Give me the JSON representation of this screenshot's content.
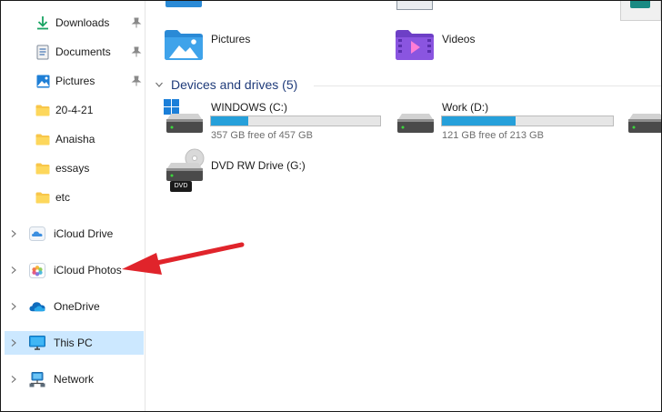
{
  "sidebar": {
    "quick_access": [
      {
        "label": "Downloads",
        "icon": "download-icon"
      },
      {
        "label": "Documents",
        "icon": "documents-icon"
      },
      {
        "label": "Pictures",
        "icon": "pictures-icon"
      },
      {
        "label": "20-4-21",
        "icon": "folder-icon"
      },
      {
        "label": "Anaisha",
        "icon": "folder-icon"
      },
      {
        "label": "essays",
        "icon": "folder-icon"
      },
      {
        "label": "etc",
        "icon": "folder-icon"
      }
    ],
    "locations": [
      {
        "label": "iCloud Drive",
        "icon": "icloud-drive-icon"
      },
      {
        "label": "iCloud Photos",
        "icon": "icloud-photos-icon"
      },
      {
        "label": "OneDrive",
        "icon": "onedrive-icon"
      },
      {
        "label": "This PC",
        "icon": "this-pc-icon",
        "selected": true
      },
      {
        "label": "Network",
        "icon": "network-icon"
      }
    ]
  },
  "main": {
    "folders": [
      {
        "label": "Pictures",
        "icon": "pictures-folder-icon"
      },
      {
        "label": "Videos",
        "icon": "videos-folder-icon"
      }
    ],
    "devices_header": "Devices and drives (5)",
    "drives": [
      {
        "name": "WINDOWS (C:)",
        "free_text": "357 GB free of 457 GB",
        "used_fraction": 0.22
      },
      {
        "name": "Work (D:)",
        "free_text": "121 GB free of 213 GB",
        "used_fraction": 0.43
      },
      {
        "name": "DVD RW Drive (G:)",
        "badge": "DVD"
      }
    ]
  },
  "colors": {
    "accent": "#26a0da",
    "selection": "#cce8ff",
    "annotation_arrow": "#e0242b",
    "header_text": "#1f3b7a"
  }
}
